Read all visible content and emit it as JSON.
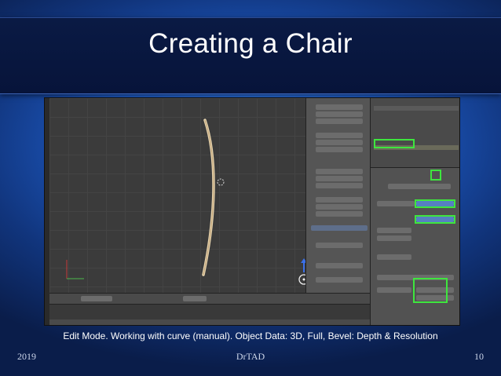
{
  "slide": {
    "title": "Creating a Chair",
    "caption": "Edit Mode. Working with curve (manual). Object Data: 3D, Full, Bevel: Depth & Resolution",
    "footer": {
      "year": "2019",
      "author": "DrTAD",
      "page": "10"
    }
  },
  "colors": {
    "title_band": "#07143a",
    "slide_blue": "#1d58bf",
    "highlight_box": "#3ee63e",
    "viewport_bg": "#3b3b3b",
    "panel_bg": "#525252"
  },
  "screenshot": {
    "app": "Blender",
    "icons": [
      "3d-cursor-icon",
      "z-axis-gizmo-icon",
      "curve-data-icon",
      "scene-icon",
      "camera-icon",
      "lamp-icon"
    ]
  }
}
